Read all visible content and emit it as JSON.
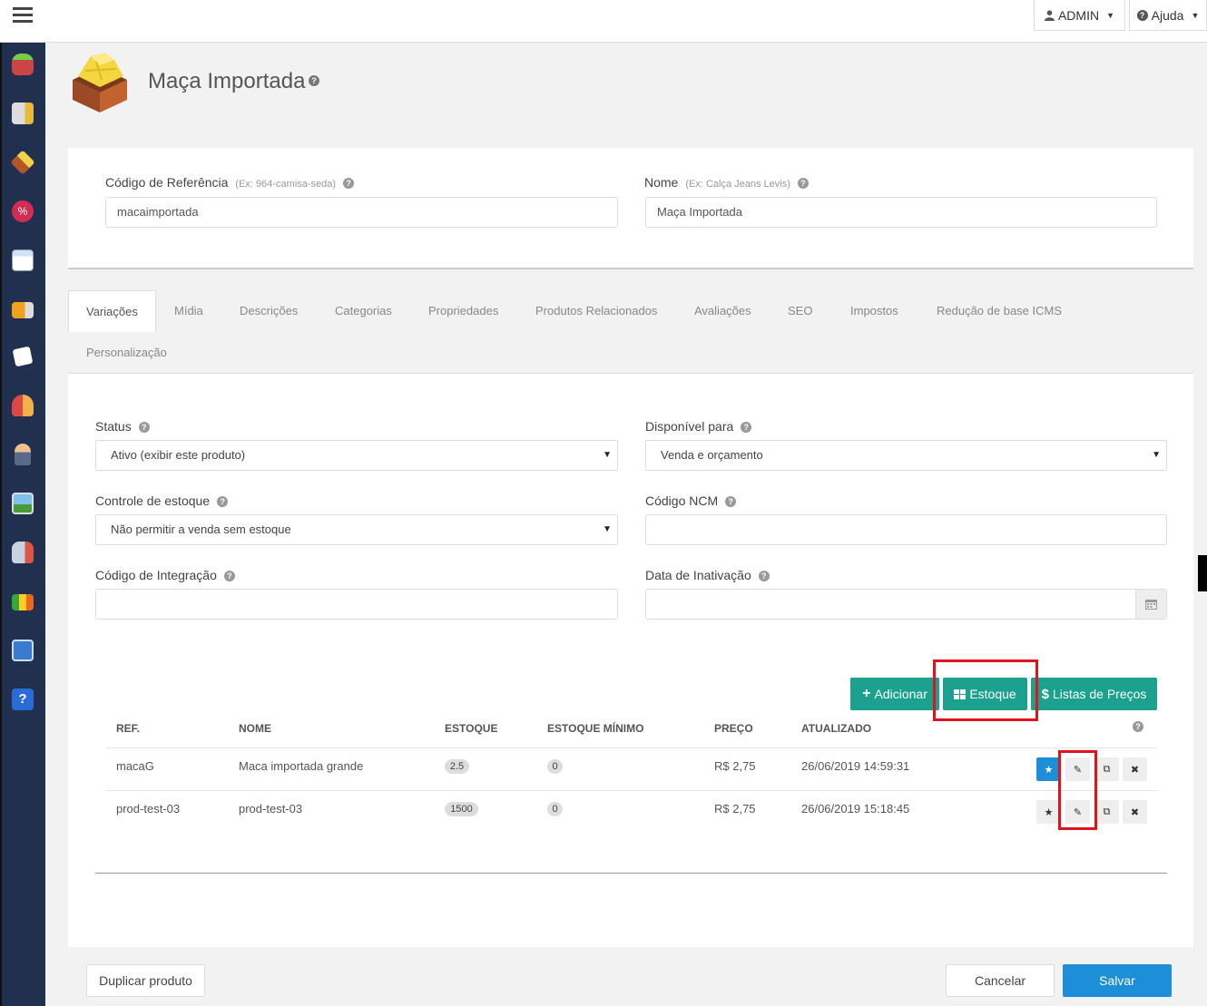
{
  "topbar": {
    "user_label": "ADMIN",
    "help_label": "Ajuda"
  },
  "sidebar": {
    "icons": [
      "database-icon",
      "store-icon",
      "product-box-icon",
      "discount-icon",
      "card-icon",
      "delivery-truck-icon",
      "document-icon",
      "users-icon",
      "person-icon",
      "image-icon",
      "database-user-icon",
      "chart-icon",
      "settings-screen-icon",
      "help-icon"
    ]
  },
  "page": {
    "title": "Maça Importada"
  },
  "form_top": {
    "ref_label": "Código de Referência",
    "ref_example": "(Ex: 964-camisa-seda)",
    "ref_value": "macaimportada",
    "name_label": "Nome",
    "name_example": "(Ex: Calça Jeans Levis)",
    "name_value": "Maça Importada"
  },
  "tabs": [
    "Variações",
    "Mídia",
    "Descrições",
    "Categorias",
    "Propriedades",
    "Produtos Relacionados",
    "Avaliações",
    "SEO",
    "Impostos",
    "Redução de base ICMS",
    "Personalização"
  ],
  "form_main": {
    "status_label": "Status",
    "status_value": "Ativo (exibir este produto)",
    "avail_label": "Disponível para",
    "avail_value": "Venda e orçamento",
    "stock_ctrl_label": "Controle de estoque",
    "stock_ctrl_value": "Não permitir a venda sem estoque",
    "ncm_label": "Código NCM",
    "ncm_value": "",
    "integ_label": "Código de Integração",
    "integ_value": "",
    "inactive_label": "Data de Inativação",
    "inactive_value": ""
  },
  "variations": {
    "add_label": "Adicionar",
    "stock_label": "Estoque",
    "prices_label": "Listas de Preços",
    "headers": [
      "REF.",
      "NOME",
      "ESTOQUE",
      "ESTOQUE MÍNIMO",
      "PREÇO",
      "ATUALIZADO"
    ],
    "rows": [
      {
        "ref": "macaG",
        "name": "Maca importada grande",
        "stock": "2.5",
        "min": "0",
        "price": "R$ 2,75",
        "updated": "26/06/2019 14:59:31"
      },
      {
        "ref": "prod-test-03",
        "name": "prod-test-03",
        "stock": "1500",
        "min": "0",
        "price": "R$ 2,75",
        "updated": "26/06/2019 15:18:45"
      }
    ]
  },
  "footer": {
    "duplicate_label": "Duplicar produto",
    "cancel_label": "Cancelar",
    "save_label": "Salvar"
  },
  "colors": {
    "sidebar": "#223050",
    "green": "#1ba18e",
    "blue": "#1d8ed8",
    "highlight": "#e0141e"
  }
}
